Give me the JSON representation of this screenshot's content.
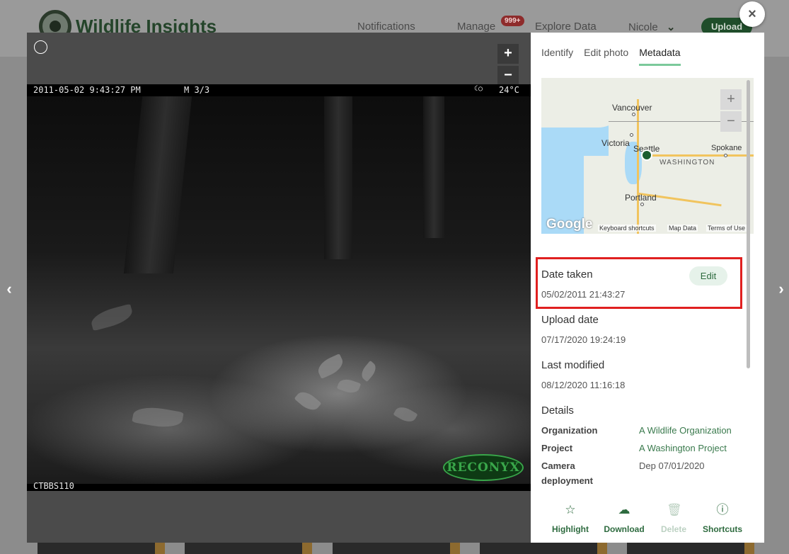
{
  "app": {
    "logo_text": "Wildlife Insights",
    "nav": {
      "notifications": "Notifications",
      "manage": "Manage",
      "manage_badge": "999+",
      "explore": "Explore Data",
      "user": "Nicole",
      "upload": "Upload"
    }
  },
  "viewer": {
    "zoom_in": "+",
    "zoom_out": "−",
    "photo_overlay": {
      "timestamp": "2011-05-02 9:43:27 PM",
      "sequence": "M 3/3",
      "moon_icon": "☾○",
      "temperature": "24°C",
      "camera_id": "CTBBS110",
      "brand": "RECONYX"
    }
  },
  "panel": {
    "tabs": [
      {
        "label": "Identify",
        "active": false
      },
      {
        "label": "Edit photo",
        "active": false
      },
      {
        "label": "Metadata",
        "active": true
      }
    ],
    "map": {
      "labels": {
        "vancouver": "Vancouver",
        "victoria": "Victoria",
        "seattle": "Seattle",
        "spokane": "Spokane",
        "washington": "WASHINGTON",
        "portland": "Portland"
      },
      "zoom_in": "+",
      "zoom_out": "−",
      "attribution": "Google",
      "keyboard_shortcuts": "Keyboard shortcuts",
      "map_data": "Map Data",
      "terms": "Terms of Use"
    },
    "date_taken": {
      "label": "Date taken",
      "value": "05/02/2011 21:43:27",
      "edit": "Edit"
    },
    "upload_date": {
      "label": "Upload date",
      "value": "07/17/2020 19:24:19"
    },
    "last_modified": {
      "label": "Last modified",
      "value": "08/12/2020 11:16:18"
    },
    "details": {
      "title": "Details",
      "organization_key": "Organization",
      "organization_val": "A Wildlife Organization",
      "project_key": "Project",
      "project_val": "A Washington Project",
      "camera_key": "Camera deployment",
      "camera_val": "Dep 07/01/2020"
    },
    "actions": {
      "highlight": "Highlight",
      "download": "Download",
      "delete": "Delete",
      "shortcuts": "Shortcuts"
    }
  },
  "close_label": "×",
  "prev_label": "‹",
  "next_label": "›",
  "colors": {
    "accent_green": "#2e6b3f",
    "tab_underline": "#7bc99b",
    "highlight_box": "#e02020",
    "map_water": "#aadaf7",
    "pin": "#1b5e30"
  }
}
